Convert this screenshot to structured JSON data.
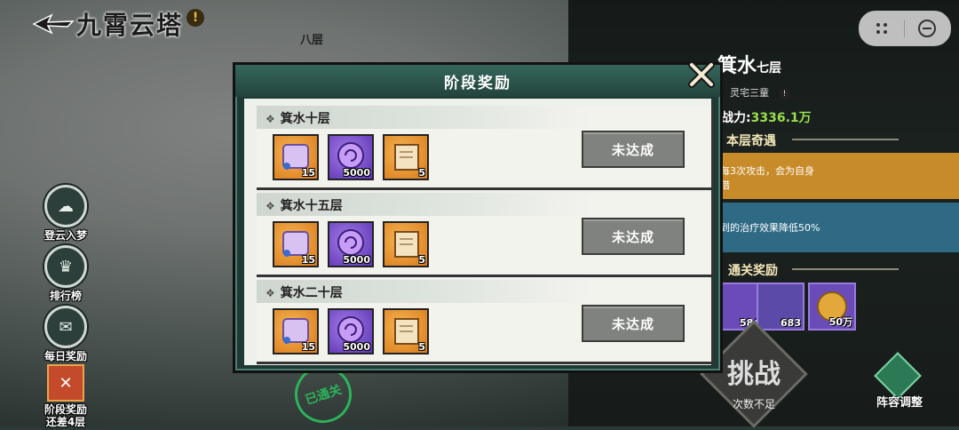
{
  "header": {
    "title": "九霄云塔",
    "info": "!",
    "tower_floor": "八层"
  },
  "left_nav": [
    {
      "label": "登云入梦",
      "icon": "cloud-dream-icon"
    },
    {
      "label": "排行榜",
      "icon": "ranking-icon"
    },
    {
      "label": "每日奖励",
      "icon": "daily-reward-icon"
    },
    {
      "label": "阶段奖励\n还差4层",
      "icon": "stage-reward-icon"
    }
  ],
  "right_panel": {
    "floor_name": "箕水",
    "floor_level": "七层",
    "boss": "灵宅三童",
    "power_label": "战力:",
    "power_value": "3336.1万",
    "special_title": "本层奇遇",
    "buff1": "每3次攻击，会为自身\n借",
    "buff2": "到的治疗效果降低50%",
    "clear_reward_title": "通关奖励",
    "clear_rewards": [
      "584",
      "683",
      "50万"
    ],
    "challenge_label": "挑战",
    "challenge_sub": "次数不足",
    "lineup_label": "阵容调整",
    "cleared_stamp": "已通关"
  },
  "modal": {
    "title": "阶段奖励",
    "stages": [
      {
        "name": "箕水十层",
        "items": [
          {
            "count": "15",
            "type": "scroll"
          },
          {
            "count": "5000",
            "type": "orb"
          },
          {
            "count": "5",
            "type": "manual"
          }
        ],
        "status": "未达成"
      },
      {
        "name": "箕水十五层",
        "items": [
          {
            "count": "15",
            "type": "scroll"
          },
          {
            "count": "5000",
            "type": "orb"
          },
          {
            "count": "5",
            "type": "manual"
          }
        ],
        "status": "未达成"
      },
      {
        "name": "箕水二十层",
        "items": [
          {
            "count": "15",
            "type": "scroll"
          },
          {
            "count": "5000",
            "type": "orb"
          },
          {
            "count": "5",
            "type": "manual"
          }
        ],
        "status": "未达成"
      }
    ]
  }
}
